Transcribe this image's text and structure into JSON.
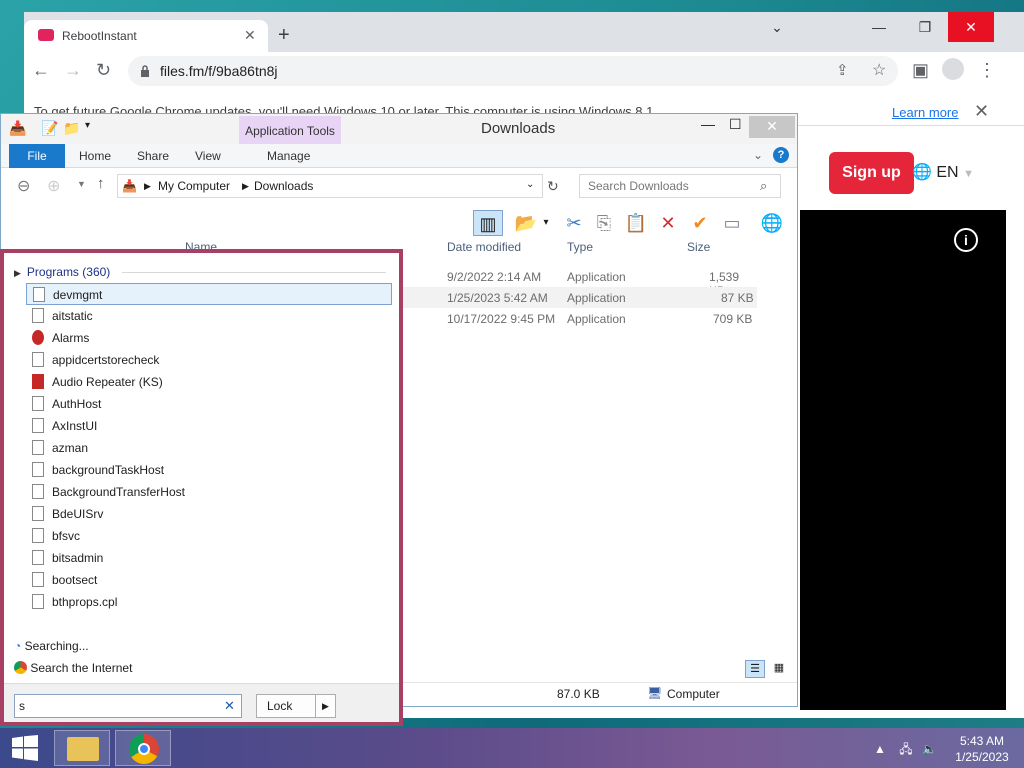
{
  "chrome": {
    "tab_title": "RebootInstant",
    "url": "files.fm/f/9ba86tn8j",
    "infobar_message": "To get future Google Chrome updates, you'll need Windows 10 or later. This computer is using Windows 8.1.",
    "infobar_link": "Learn more",
    "site_signup": "Sign up",
    "site_lang": "EN",
    "info_icon": "i"
  },
  "explorer": {
    "title": "Downloads",
    "app_tools": "Application Tools",
    "ribbon_tabs": {
      "file": "File",
      "home": "Home",
      "share": "Share",
      "view": "View",
      "manage": "Manage"
    },
    "breadcrumb": {
      "root": "My Computer",
      "folder": "Downloads"
    },
    "search_placeholder": "Search Downloads",
    "columns": {
      "name": "Name",
      "date": "Date modified",
      "type": "Type",
      "size": "Size"
    },
    "files": [
      {
        "date": "9/2/2022 2:14 AM",
        "type": "Application",
        "size": "1,539 KB"
      },
      {
        "date": "1/25/2023 5:42 AM",
        "type": "Application",
        "size": "87 KB"
      },
      {
        "date": "10/17/2022 9:45 PM",
        "type": "Application",
        "size": "709 KB"
      }
    ],
    "status_size": "87.0 KB",
    "status_location": "Computer"
  },
  "startmenu": {
    "programs_header": "Programs (360)",
    "programs": [
      "devmgmt",
      "aitstatic",
      "Alarms",
      "appidcertstorecheck",
      "Audio Repeater (KS)",
      "AuthHost",
      "AxInstUI",
      "azman",
      "backgroundTaskHost",
      "BackgroundTransferHost",
      "BdeUISrv",
      "bfsvc",
      "bitsadmin",
      "bootsect",
      "bthprops.cpl"
    ],
    "searching": "Searching...",
    "search_internet": "Search the Internet",
    "search_value": "s",
    "lock_label": "Lock"
  },
  "taskbar": {
    "time": "5:43 AM",
    "date": "1/25/2023"
  }
}
